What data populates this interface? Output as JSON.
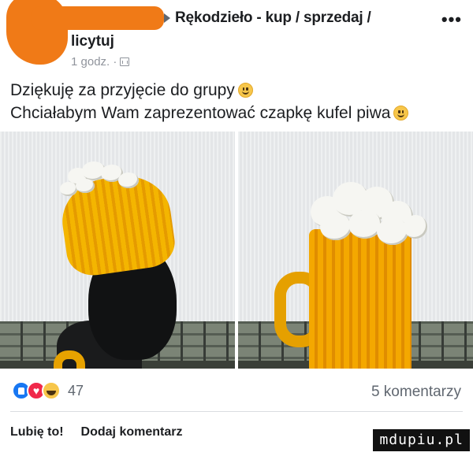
{
  "header": {
    "group_name": "Rękodzieło - kup / sprzedaj /",
    "group_name_cont": "licytuj",
    "more": "•••",
    "time": "1 godz. ·"
  },
  "post": {
    "line1": "Dziękuję za przyjęcie do grupy",
    "line2": "Chciałabym Wam zaprezentować czapkę kufel piwa"
  },
  "reactions": {
    "types": [
      "like",
      "love",
      "haha"
    ],
    "count": "47"
  },
  "comments_count": "5 komentarzy",
  "actions": {
    "like": "Lubię to!",
    "comment": "Dodaj komentarz"
  },
  "watermark": "mdupiu.pl",
  "colors": {
    "redaction": "#f07a17",
    "like": "#1877f2",
    "love": "#f0284a",
    "haha": "#f7c64a",
    "knit_yellow": "#f4b500"
  }
}
